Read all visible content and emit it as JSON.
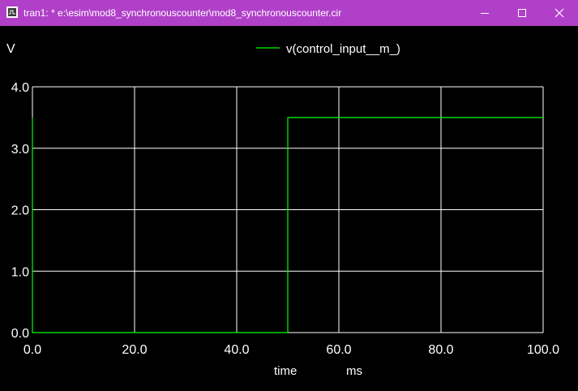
{
  "window": {
    "title": "tran1: * e:\\esim\\mod8_synchronouscounter\\mod8_synchronouscounter.cir",
    "controls": {
      "minimize_icon": "minimize-icon",
      "maximize_icon": "maximize-icon",
      "close_icon": "close-icon"
    },
    "titlebar_color": "#b040c8"
  },
  "chart_data": {
    "type": "line",
    "title": "",
    "y_unit_label": "V",
    "x_quantity_label": "time",
    "x_unit_label": "ms",
    "xlim": [
      0,
      100
    ],
    "ylim": [
      0,
      4
    ],
    "x_ticks": [
      0,
      20,
      40,
      60,
      80,
      100
    ],
    "x_tick_labels": [
      "0.0",
      "20.0",
      "40.0",
      "60.0",
      "80.0",
      "100.0"
    ],
    "y_ticks": [
      0,
      1,
      2,
      3,
      4
    ],
    "y_tick_labels": [
      "0.0",
      "1.0",
      "2.0",
      "3.0",
      "4.0"
    ],
    "grid": true,
    "legend_position": "top-center",
    "background_color": "#000000",
    "grid_color": "#ffffff",
    "series": [
      {
        "name": "v(control_input__m_)",
        "color": "#00ff00",
        "x": [
          0,
          0,
          0.2,
          0.2,
          50,
          50,
          100
        ],
        "y": [
          3.5,
          0,
          0,
          0,
          0,
          3.5,
          3.5
        ]
      }
    ]
  }
}
